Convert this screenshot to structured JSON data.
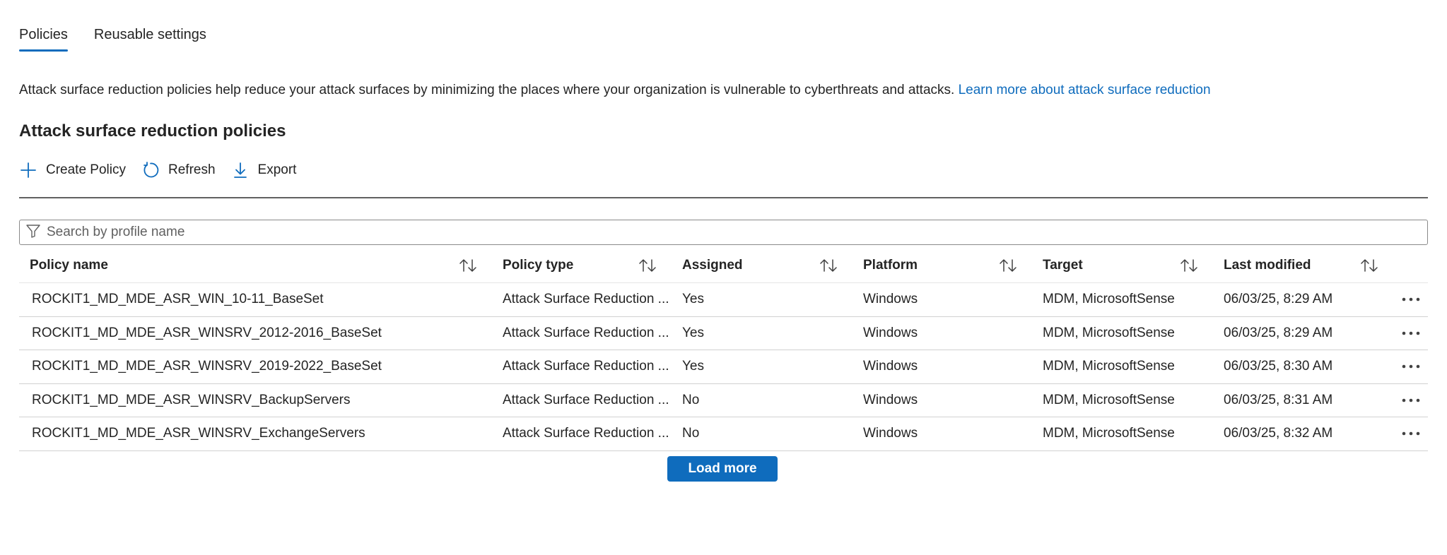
{
  "tabs": [
    {
      "label": "Policies",
      "active": true
    },
    {
      "label": "Reusable settings",
      "active": false
    }
  ],
  "description": {
    "text": "Attack surface reduction policies help reduce your attack surfaces by minimizing the places where your organization is vulnerable to cyberthreats and attacks.",
    "link": "Learn more about attack surface reduction"
  },
  "section_title": "Attack surface reduction policies",
  "toolbar": {
    "create_label": "Create Policy",
    "refresh_label": "Refresh",
    "export_label": "Export"
  },
  "search": {
    "placeholder": "Search by profile name",
    "value": ""
  },
  "table": {
    "columns": [
      "Policy name",
      "Policy type",
      "Assigned",
      "Platform",
      "Target",
      "Last modified"
    ],
    "rows": [
      {
        "name": "ROCKIT1_MD_MDE_ASR_WIN_10-11_BaseSet",
        "type": "Attack Surface Reduction ...",
        "assigned": "Yes",
        "platform": "Windows",
        "target": "MDM, MicrosoftSense",
        "modified": "06/03/25, 8:29 AM"
      },
      {
        "name": "ROCKIT1_MD_MDE_ASR_WINSRV_2012-2016_BaseSet",
        "type": "Attack Surface Reduction ...",
        "assigned": "Yes",
        "platform": "Windows",
        "target": "MDM, MicrosoftSense",
        "modified": "06/03/25, 8:29 AM"
      },
      {
        "name": "ROCKIT1_MD_MDE_ASR_WINSRV_2019-2022_BaseSet",
        "type": "Attack Surface Reduction ...",
        "assigned": "Yes",
        "platform": "Windows",
        "target": "MDM, MicrosoftSense",
        "modified": "06/03/25, 8:30 AM"
      },
      {
        "name": "ROCKIT1_MD_MDE_ASR_WINSRV_BackupServers",
        "type": "Attack Surface Reduction ...",
        "assigned": "No",
        "platform": "Windows",
        "target": "MDM, MicrosoftSense",
        "modified": "06/03/25, 8:31 AM"
      },
      {
        "name": "ROCKIT1_MD_MDE_ASR_WINSRV_ExchangeServers",
        "type": "Attack Surface Reduction ...",
        "assigned": "No",
        "platform": "Windows",
        "target": "MDM, MicrosoftSense",
        "modified": "06/03/25, 8:32 AM"
      }
    ]
  },
  "load_more_label": "Load more",
  "colors": {
    "accent": "#0f6cbd",
    "text": "#242424",
    "divider": "#d1d1d1"
  },
  "icons": {
    "create": "plus-icon",
    "refresh": "refresh-icon",
    "export": "download-icon",
    "search": "filter-icon",
    "sort": "sort-icon",
    "row_actions": "more-icon"
  }
}
